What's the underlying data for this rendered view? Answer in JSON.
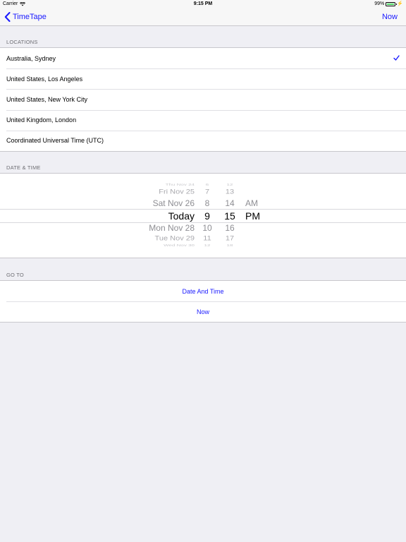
{
  "status_bar": {
    "carrier": "Carrier",
    "time": "9:15 PM",
    "battery": "99%"
  },
  "nav": {
    "back_label": "TimeTape",
    "right_label": "Now"
  },
  "locations": {
    "header": "LOCATIONS",
    "items": [
      {
        "label": "Australia, Sydney",
        "checked": true
      },
      {
        "label": "United States, Los Angeles",
        "checked": false
      },
      {
        "label": "United States, New York City",
        "checked": false
      },
      {
        "label": "United Kingdom, London",
        "checked": false
      },
      {
        "label": "Coordinated Universal Time (UTC)",
        "checked": false
      }
    ]
  },
  "datetime": {
    "header": "DATE & TIME",
    "picker": {
      "dates": [
        "Thu Nov 24",
        "Fri Nov 25",
        "Sat Nov 26",
        "Today",
        "Mon Nov 28",
        "Tue Nov 29",
        "Wed Nov 30"
      ],
      "hours": [
        "6",
        "7",
        "8",
        "9",
        "10",
        "11",
        "12"
      ],
      "minutes": [
        "12",
        "13",
        "14",
        "15",
        "16",
        "17",
        "18"
      ],
      "ampm": [
        "AM",
        "PM"
      ],
      "selected": {
        "date": "Today",
        "hour": "9",
        "minute": "15",
        "ampm": "PM"
      }
    }
  },
  "goto": {
    "header": "GO TO",
    "items": [
      "Date And Time",
      "Now"
    ]
  },
  "colors": {
    "accent": "#1a1aff",
    "background": "#efeff4"
  }
}
